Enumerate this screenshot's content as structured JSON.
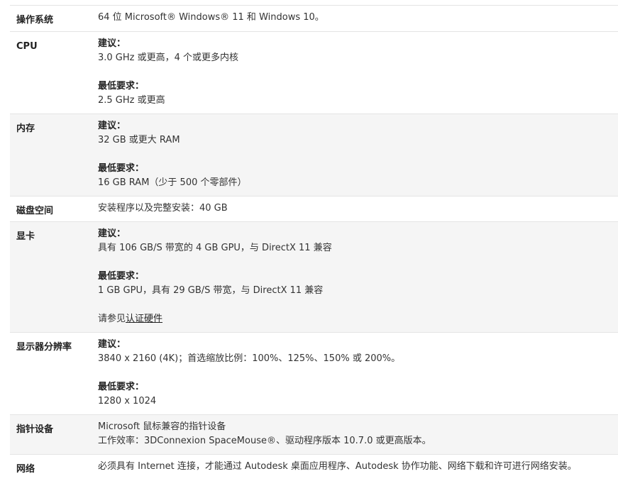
{
  "rows": [
    {
      "label": "操作系统",
      "value_line": "64 位 Microsoft® Windows® 11 和 Windows 10。"
    },
    {
      "label": "CPU",
      "recommended_heading": "建议：",
      "recommended_value": "3.0 GHz 或更高，4 个或更多内核",
      "minimum_heading": "最低要求：",
      "minimum_value": "2.5 GHz 或更高"
    },
    {
      "label": "内存",
      "recommended_heading": "建议：",
      "recommended_value": "32 GB 或更大 RAM",
      "minimum_heading": "最低要求：",
      "minimum_value": "16 GB RAM（少于 500 个零部件）"
    },
    {
      "label": "磁盘空间",
      "value_line": "安装程序以及完整安装：40 GB"
    },
    {
      "label": "显卡",
      "recommended_heading": "建议：",
      "recommended_value": "具有 106 GB/S 带宽的 4 GB GPU，与 DirectX 11 兼容",
      "minimum_heading": "最低要求：",
      "minimum_value": "1 GB GPU，具有 29 GB/S 带宽，与 DirectX 11 兼容",
      "see_prefix": "请参见",
      "see_link": "认证硬件"
    },
    {
      "label": "显示器分辨率",
      "recommended_heading": "建议：",
      "recommended_value": "3840 x 2160 (4K)；首选缩放比例：100%、125%、150% 或 200%。",
      "minimum_heading": "最低要求：",
      "minimum_value": "1280 x 1024"
    },
    {
      "label": "指针设备",
      "line1": "Microsoft 鼠标兼容的指针设备",
      "line2": "工作效率：3DConnexion SpaceMouse®、驱动程序版本 10.7.0 或更高版本。"
    },
    {
      "label": "网络",
      "value_line": "必须具有 Internet 连接，才能通过 Autodesk 桌面应用程序、Autodesk 协作功能、网络下载和许可进行网络安装。"
    }
  ]
}
